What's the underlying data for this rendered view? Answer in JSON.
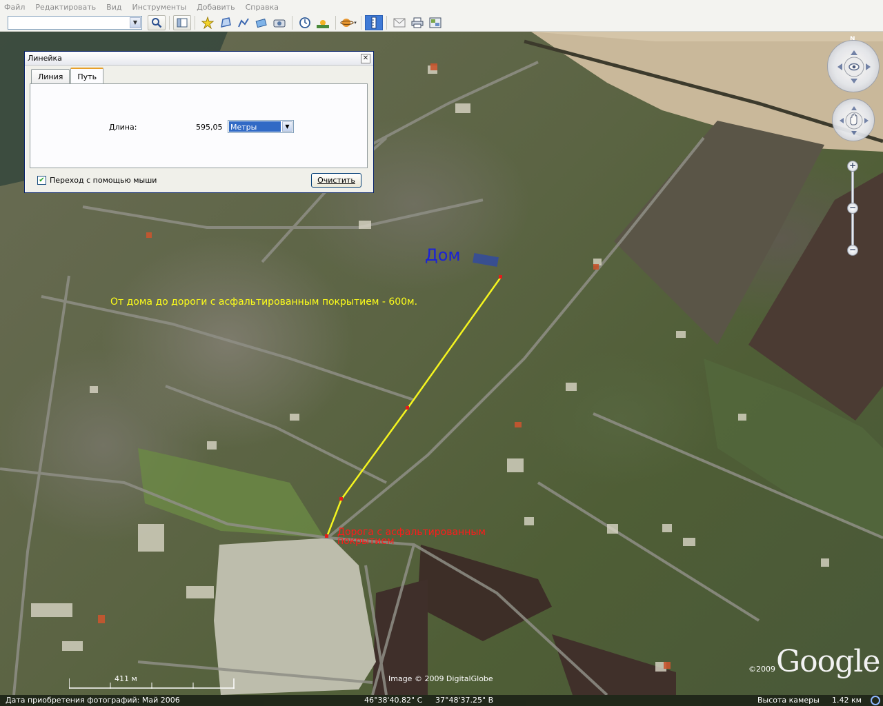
{
  "menu": [
    "Файл",
    "Редактировать",
    "Вид",
    "Инструменты",
    "Добавить",
    "Справка"
  ],
  "search": {
    "value": ""
  },
  "ruler": {
    "title": "Линейка",
    "tabs": [
      "Линия",
      "Путь"
    ],
    "active_tab": "Путь",
    "length_label": "Длина:",
    "length_value": "595,05",
    "units": "Метры",
    "mouse_nav_label": "Переход с помощью мыши",
    "mouse_nav_checked": true,
    "clear_label": "Очистить"
  },
  "map_labels": {
    "home": "Дом",
    "distance": "От дома до дороги с асфальтированным покрытием - 600м.",
    "road_line1": "Дорога с асфальтированным",
    "road_line2": "покрытием"
  },
  "nav": {
    "north": "N",
    "zoom_in": "+",
    "zoom_out": "−"
  },
  "scale": {
    "label": "411 м"
  },
  "credits": {
    "image": "Image © 2009 DigitalGlobe",
    "year": "©2009",
    "logo": "Google"
  },
  "status": {
    "photo_date": "Дата приобретения фотографий: Май 2006",
    "lat": "46°38'40.82\" С",
    "lon": "37°48'37.25\" В",
    "camera_label": "Высота камеры",
    "camera_value": "1.42 км"
  },
  "colors": {
    "path": "#f5f51f",
    "home_label": "#1b22d6",
    "road_label": "#ff1a1a",
    "distance_label": "#ffff1a"
  }
}
